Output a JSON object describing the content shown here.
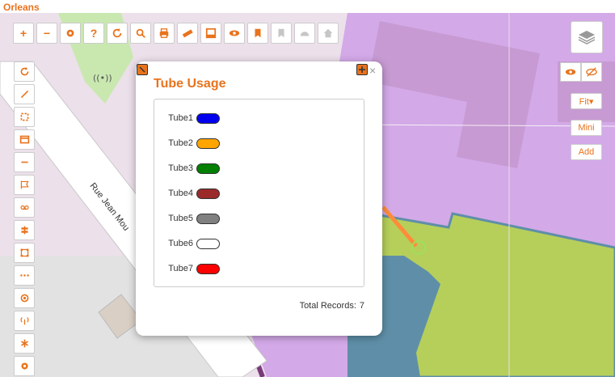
{
  "app": {
    "title": "Orleans"
  },
  "map": {
    "street_label": "Rue Jean Mou"
  },
  "toolbar": {
    "buttons": [
      {
        "name": "zoom-in",
        "glyph": "+"
      },
      {
        "name": "zoom-out",
        "glyph": "−"
      },
      {
        "name": "settings",
        "glyph": "gear"
      },
      {
        "name": "help",
        "glyph": "?"
      },
      {
        "name": "refresh",
        "glyph": "refresh"
      },
      {
        "name": "search",
        "glyph": "search"
      },
      {
        "name": "print",
        "glyph": "print"
      },
      {
        "name": "measure",
        "glyph": "ruler"
      },
      {
        "name": "frame",
        "glyph": "frame"
      },
      {
        "name": "view",
        "glyph": "eye"
      },
      {
        "name": "bookmark",
        "glyph": "bookmark"
      },
      {
        "name": "bookmark-disabled",
        "glyph": "bookmark"
      },
      {
        "name": "dome-disabled",
        "glyph": "dome"
      },
      {
        "name": "home-disabled",
        "glyph": "home"
      }
    ],
    "help_glyph": "?",
    "plus_glyph": "+",
    "minus_glyph": "−"
  },
  "right_panel": {
    "fit_label": "Fit▾",
    "mini_label": "Mini",
    "add_label": "Add"
  },
  "popup": {
    "title": "Tube Usage",
    "close_glyph": "×",
    "legend": [
      {
        "label": "Tube1",
        "color": "#0000ee"
      },
      {
        "label": "Tube2",
        "color": "#ffa500"
      },
      {
        "label": "Tube3",
        "color": "#007f00"
      },
      {
        "label": "Tube4",
        "color": "#9b2a2a"
      },
      {
        "label": "Tube5",
        "color": "#808080"
      },
      {
        "label": "Tube6",
        "color": "#ffffff"
      },
      {
        "label": "Tube7",
        "color": "#ff0000"
      }
    ],
    "total_label": "Total Records:",
    "total_value": "7"
  },
  "colors": {
    "accent": "#e8731c",
    "map_bg": "#ece0ea",
    "purple_zone": "#d3a9e8",
    "green_zone": "#b6cf5a",
    "blue_zone": "#5f8fa8",
    "park_green": "#c9e8b0"
  }
}
